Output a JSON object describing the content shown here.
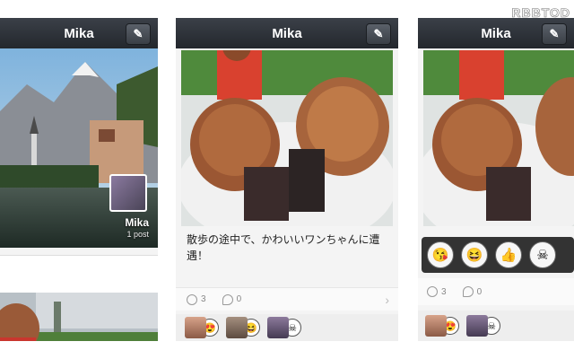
{
  "watermark": "RBBTOD",
  "screens": [
    {
      "header": {
        "title": "Mika",
        "edit_icon": "pencil-icon"
      },
      "profile": {
        "name": "Mika",
        "posts": "1 post"
      }
    },
    {
      "header": {
        "title": "Mika",
        "edit_icon": "pencil-icon"
      },
      "post": {
        "caption": "散歩の途中で、かわいいワンちゃんに遭遇！",
        "like_count": "3",
        "comment_count": "0"
      },
      "reactions": [
        "heart-eyes",
        "laughing",
        "skull"
      ]
    },
    {
      "header": {
        "title": "Mika",
        "edit_icon": "pencil-icon"
      },
      "sticker_picker": [
        "heart-kiss",
        "laughing",
        "thumbs-up",
        "skull"
      ],
      "post": {
        "like_count": "3",
        "comment_count": "0"
      },
      "reactions": [
        "heart-eyes",
        "skull"
      ]
    }
  ],
  "colors": {
    "header_bg": "#2b2f35",
    "sheet": "#f4f4f4"
  }
}
